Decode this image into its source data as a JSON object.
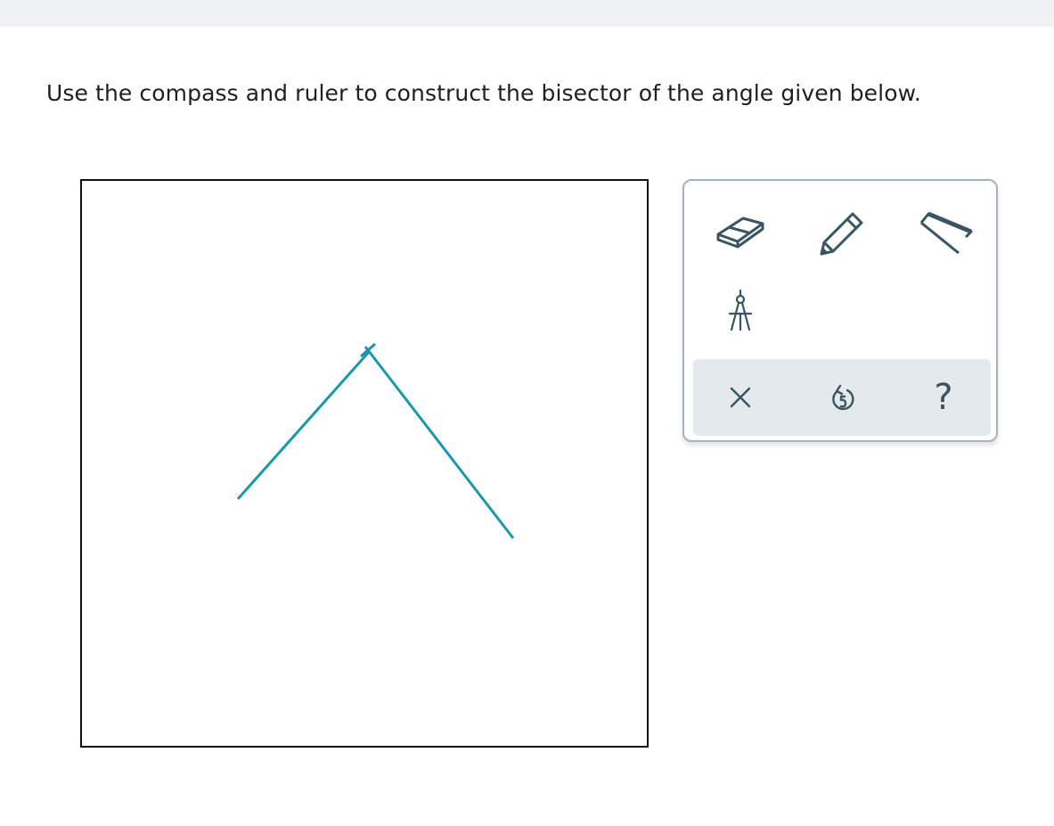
{
  "prompt": {
    "text": "Use the compass and ruler to construct the bisector of the angle given below."
  },
  "colors": {
    "top_bar": "#eef2f3",
    "angle_stroke": "#1a98aa",
    "canvas_border": "#111111",
    "toolbox_border": "#9fb6c2",
    "icon": "#3a5560",
    "action_bar": "#e3e9ec"
  },
  "canvas": {
    "figure": "angle with two rays meeting at a marked vertex"
  },
  "toolbox": {
    "tools": [
      {
        "name": "eraser",
        "icon": "eraser-icon"
      },
      {
        "name": "pencil",
        "icon": "pencil-icon"
      },
      {
        "name": "ruler",
        "icon": "ruler-icon"
      },
      {
        "name": "compass",
        "icon": "compass-icon"
      }
    ],
    "actions": [
      {
        "name": "clear",
        "icon": "close-icon"
      },
      {
        "name": "undo",
        "icon": "undo-icon"
      },
      {
        "name": "help",
        "icon": "help-icon",
        "label": "?"
      }
    ]
  }
}
